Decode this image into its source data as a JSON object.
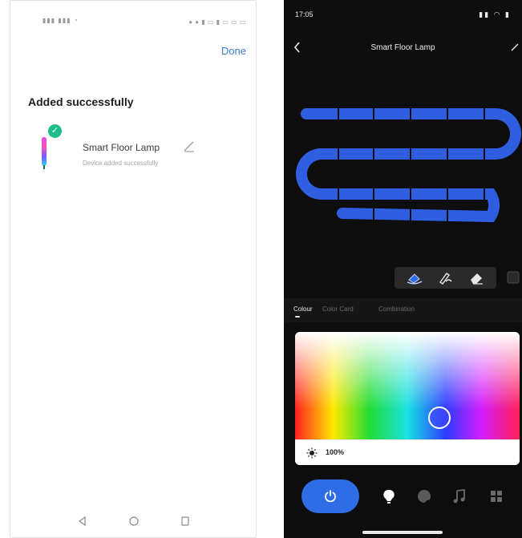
{
  "left_screen": {
    "status": {
      "signal_text": "",
      "right_text": ""
    },
    "done_label": "Done",
    "title": "Added successfully",
    "device": {
      "name": "Smart Floor Lamp",
      "subtitle": "Device added successfully",
      "badge_icon": "check-icon",
      "lamp_colors": [
        "#d74cf2",
        "#ff4fb6",
        "#7b59ff",
        "#27d6ff"
      ],
      "badge_color": "#1fbc8c"
    },
    "nav_icons": [
      "back-triangle-icon",
      "home-circle-icon",
      "recents-square-icon"
    ],
    "accent": "#3a7bd5"
  },
  "right_screen": {
    "status": {
      "time": "17:05",
      "icons_text": ""
    },
    "header_title": "Smart Floor Lamp",
    "strip_color": "#2f5fe0",
    "tool_icons": [
      "paint-bucket-icon",
      "brush-icon",
      "eraser-icon",
      "square-icon"
    ],
    "tabs": [
      {
        "label": "Colour",
        "active": true
      },
      {
        "label": "Color Card",
        "active": false
      },
      {
        "label": "Combination",
        "active": false
      }
    ],
    "brightness": "100%",
    "bottom_icons": [
      "power-icon",
      "bulb-icon",
      "palette-icon",
      "music-icon",
      "grid-icon"
    ],
    "power_color": "#2f6de6"
  }
}
